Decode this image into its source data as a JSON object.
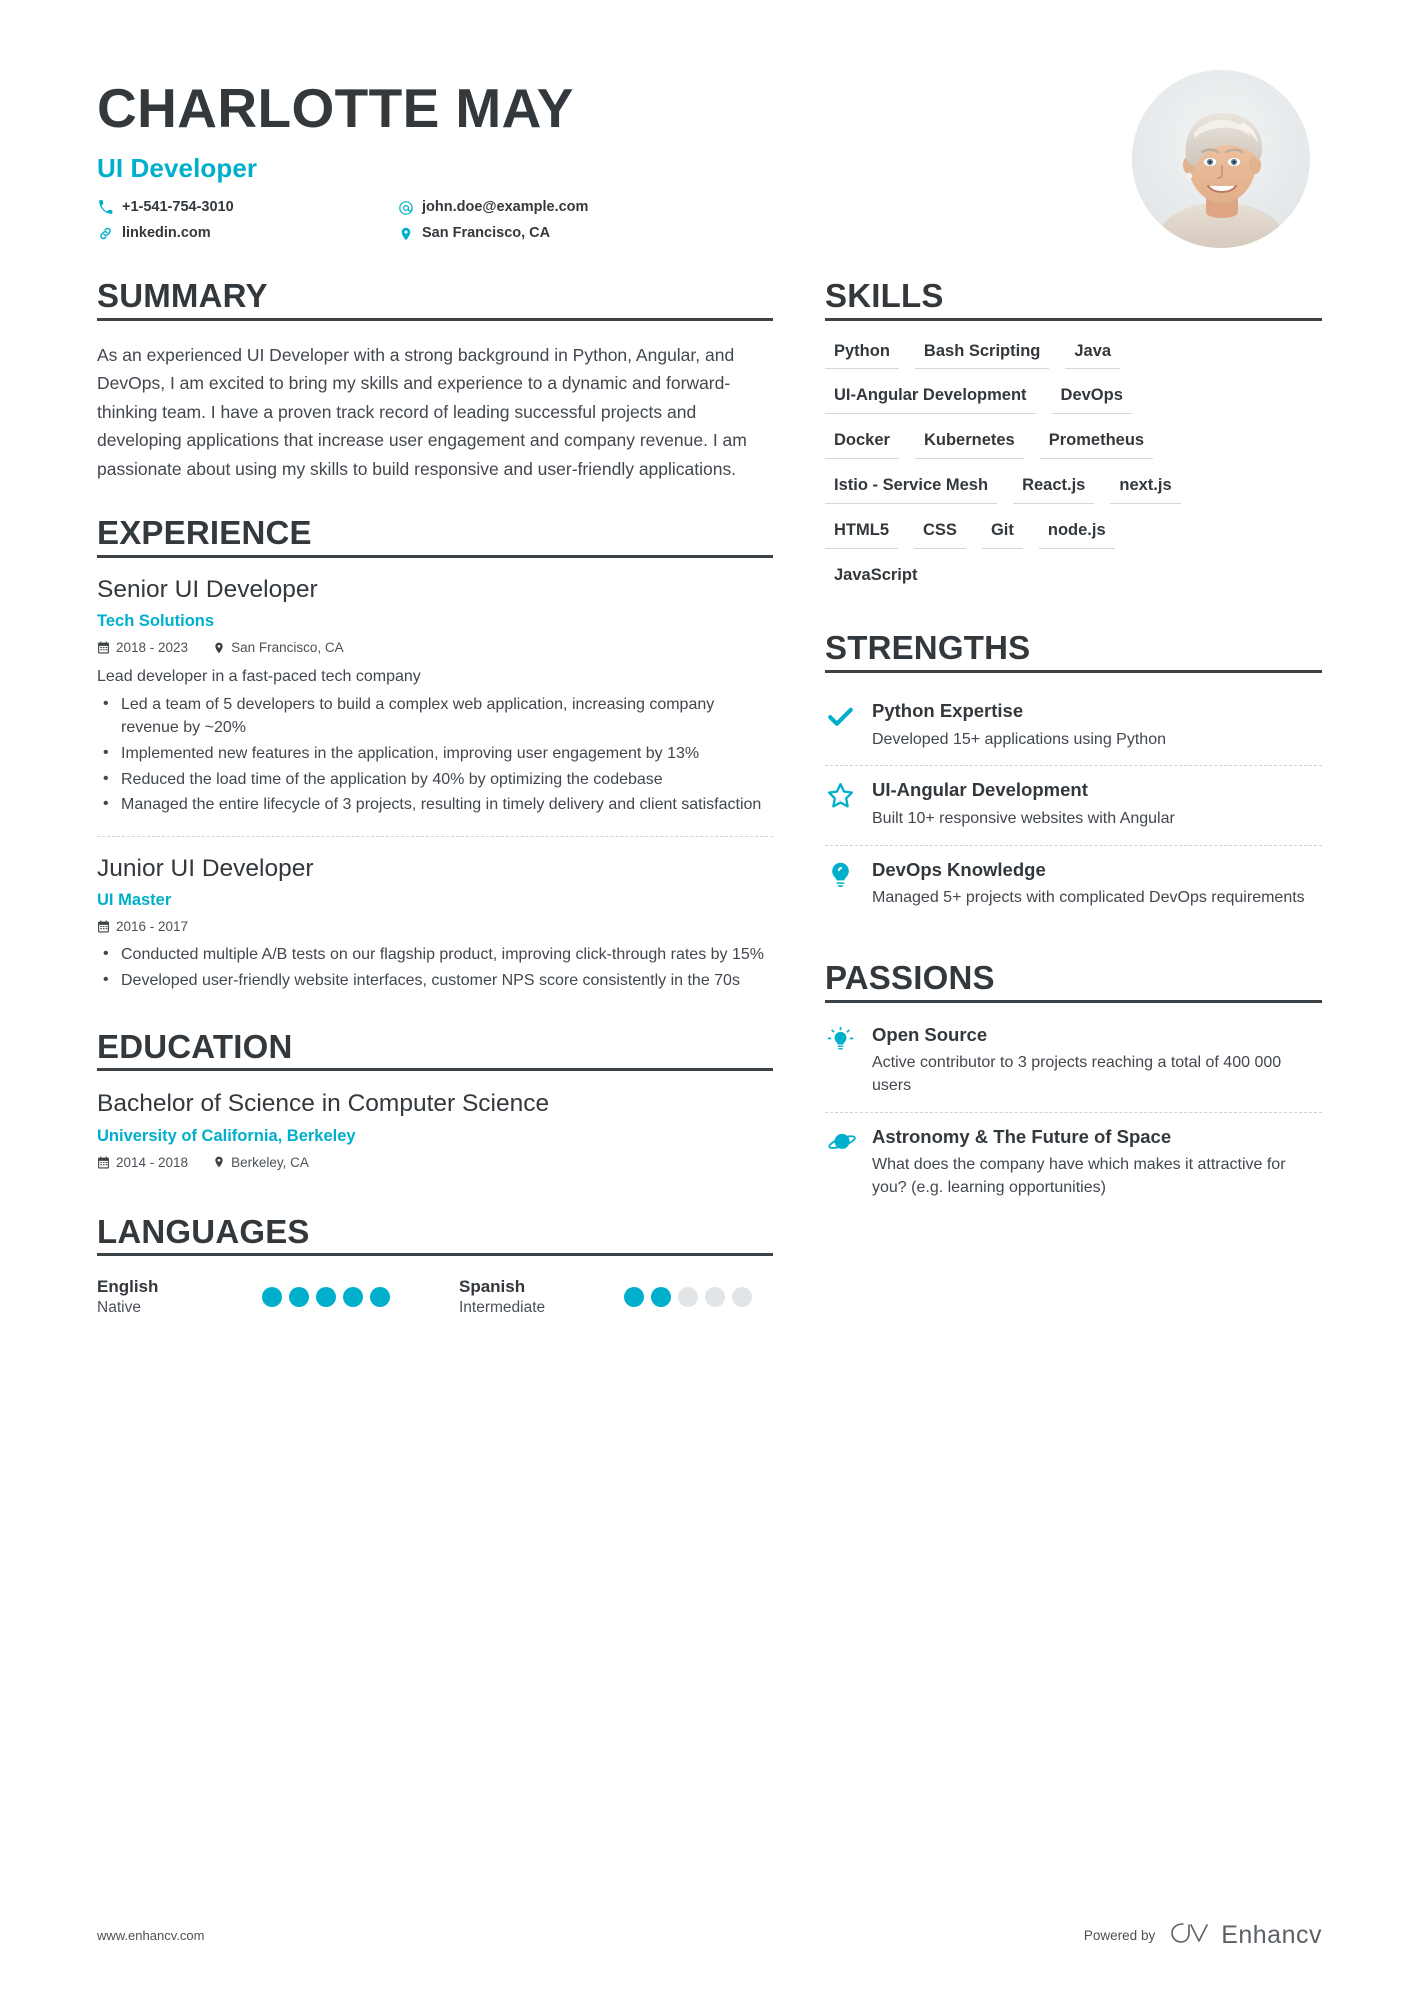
{
  "header": {
    "full_name": "CHARLOTTE MAY",
    "job_title": "UI Developer",
    "contacts": [
      {
        "icon": "phone-icon",
        "text": "+1-541-754-3010"
      },
      {
        "icon": "link-icon",
        "text": "linkedin.com"
      },
      {
        "icon": "at-email-icon",
        "text": "john.doe@example.com"
      },
      {
        "icon": "location-pin-icon",
        "text": "San Francisco, CA"
      }
    ],
    "photo_alt": "profile-photo"
  },
  "accent_color": "#00AFCB",
  "text_color": "#33383d",
  "sections": {
    "summary": {
      "title": "SUMMARY",
      "text": "As an experienced UI Developer with a strong background in Python, Angular, and DevOps, I am excited to bring my skills and experience to a dynamic and forward-thinking team. I have a proven track record of leading successful projects and developing applications that increase user engagement and company revenue. I am passionate about using my skills to build responsive and user-friendly applications."
    },
    "experience": {
      "title": "EXPERIENCE",
      "entries": [
        {
          "role": "Senior UI Developer",
          "company": "Tech Solutions",
          "dates": "2018 - 2023",
          "location": "San Francisco, CA",
          "description": "Lead developer in a fast-paced tech company",
          "bullets": [
            "Led a team of 5 developers to build a complex web application, increasing company revenue by ~20%",
            "Implemented new features in the application, improving user engagement by 13%",
            "Reduced the load time of the application by 40% by optimizing the codebase",
            "Managed the entire lifecycle of 3 projects, resulting in timely delivery and client satisfaction"
          ]
        },
        {
          "role": "Junior UI Developer",
          "company": "UI Master",
          "dates": "2016 - 2017",
          "location": "",
          "description": "",
          "bullets": [
            "Conducted multiple A/B tests on our flagship product, improving click-through rates by 15%",
            "Developed user-friendly website interfaces, customer NPS score consistently in the 70s"
          ]
        }
      ]
    },
    "education": {
      "title": "EDUCATION",
      "entries": [
        {
          "degree": "Bachelor of Science in Computer Science",
          "school": "University of California, Berkeley",
          "dates": "2014 - 2018",
          "location": "Berkeley, CA"
        }
      ]
    },
    "languages": {
      "title": "LANGUAGES",
      "items": [
        {
          "name": "English",
          "level": "Native",
          "rating": 5,
          "max": 5
        },
        {
          "name": "Spanish",
          "level": "Intermediate",
          "rating": 2,
          "max": 5
        }
      ]
    },
    "skills": {
      "title": "SKILLS",
      "rows": [
        [
          "Python",
          "Bash Scripting",
          "Java"
        ],
        [
          "UI-Angular Development",
          "DevOps"
        ],
        [
          "Docker",
          "Kubernetes",
          "Prometheus"
        ],
        [
          "Istio - Service Mesh",
          "React.js",
          "next.js"
        ],
        [
          "HTML5",
          "CSS",
          "Git",
          "node.js"
        ],
        [
          "JavaScript"
        ]
      ]
    },
    "strengths": {
      "title": "STRENGTHS",
      "items": [
        {
          "icon": "check-icon",
          "title": "Python Expertise",
          "desc": "Developed 15+ applications using Python"
        },
        {
          "icon": "star-icon",
          "title": "UI-Angular Development",
          "desc": "Built 10+ responsive websites with Angular"
        },
        {
          "icon": "lightbulb-icon",
          "title": "DevOps Knowledge",
          "desc": "Managed 5+ projects with complicated DevOps requirements"
        }
      ]
    },
    "passions": {
      "title": "PASSIONS",
      "items": [
        {
          "icon": "idea-lightbulb-icon",
          "title": "Open Source",
          "desc": "Active contributor to 3 projects reaching a total of 400 000 users"
        },
        {
          "icon": "planet-saturn-icon",
          "title": "Astronomy & The Future of Space",
          "desc": "What does the company have which makes it attractive for you? (e.g. learning opportunities)"
        }
      ]
    }
  },
  "footer": {
    "url": "www.enhancv.com",
    "powered_by": "Powered by",
    "brand": "Enhancv"
  }
}
